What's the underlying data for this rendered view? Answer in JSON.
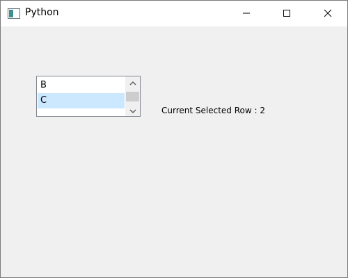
{
  "window": {
    "title": "Python",
    "app_icon": "window-app-icon",
    "controls": {
      "minimize_icon": "minimize-icon",
      "maximize_icon": "maximize-icon",
      "close_icon": "close-icon"
    }
  },
  "list": {
    "items": [
      {
        "label": "B",
        "selected": false
      },
      {
        "label": "C",
        "selected": true
      }
    ],
    "scrollbar": {
      "up_icon": "chevron-up-icon",
      "down_icon": "chevron-down-icon"
    }
  },
  "status": {
    "text": "Current Selected Row : 2"
  },
  "colors": {
    "selection": "#cce8ff",
    "client_background": "#f0f0f0",
    "titlebar_background": "#ffffff"
  }
}
